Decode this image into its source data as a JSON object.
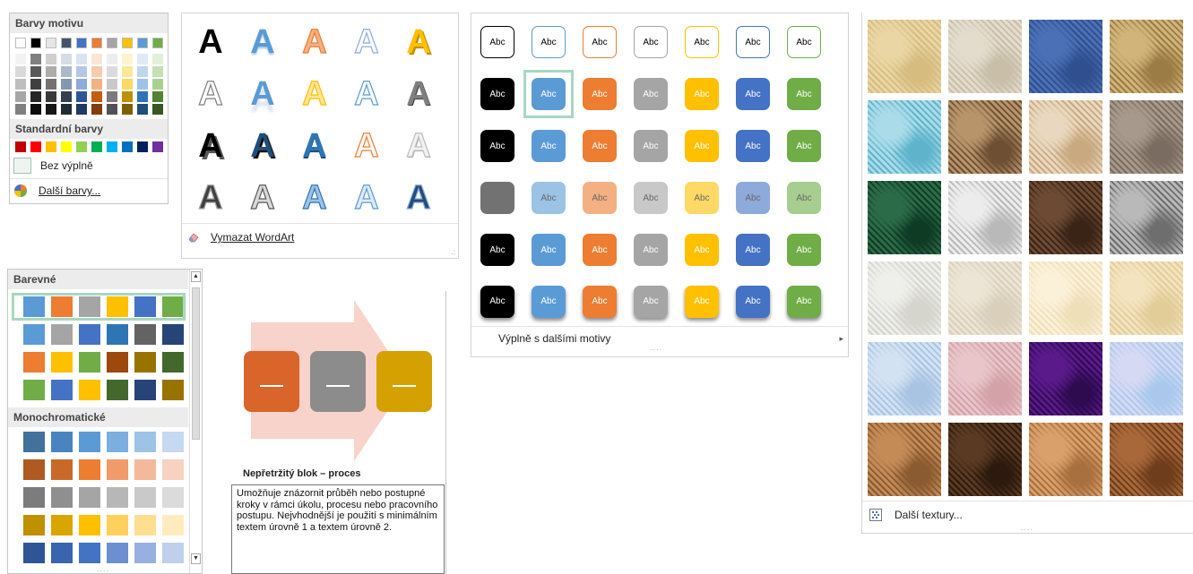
{
  "theme_colors": {
    "header": "Barvy motivu",
    "standard_header": "Standardní barvy",
    "no_fill_label": "Bez výplně",
    "more_colors_label": "Další barvy...",
    "top_row": [
      "#ffffff",
      "#000000",
      "#e7e6e6",
      "#44546a",
      "#4472c4",
      "#ed7d31",
      "#a5a5a5",
      "#ffc000",
      "#5b9bd5",
      "#70ad47"
    ],
    "shade_columns": [
      [
        "#f2f2f2",
        "#d9d9d9",
        "#bfbfbf",
        "#a6a6a6",
        "#808080"
      ],
      [
        "#808080",
        "#595959",
        "#404040",
        "#262626",
        "#0d0d0d"
      ],
      [
        "#d0cece",
        "#aeabab",
        "#757171",
        "#3a3838",
        "#171616"
      ],
      [
        "#d6dce4",
        "#adb9ca",
        "#8497b0",
        "#333f4f",
        "#222a35"
      ],
      [
        "#dae3f3",
        "#b4c7e7",
        "#8faadc",
        "#2f5597",
        "#203864"
      ],
      [
        "#fbe5d6",
        "#f8cbad",
        "#f4b183",
        "#c55a11",
        "#843c0c"
      ],
      [
        "#ededed",
        "#dbdbdb",
        "#c9c9c9",
        "#7b7b7b",
        "#525252"
      ],
      [
        "#fff2cc",
        "#ffe699",
        "#ffd966",
        "#bf9000",
        "#7f6000"
      ],
      [
        "#deebf7",
        "#bdd7ee",
        "#9dc3e6",
        "#2e75b6",
        "#1f4e79"
      ],
      [
        "#e2f0d9",
        "#c5e0b4",
        "#a9d18e",
        "#548235",
        "#385723"
      ]
    ],
    "standard_row": [
      "#c00000",
      "#ff0000",
      "#ffc000",
      "#ffff00",
      "#92d050",
      "#00b050",
      "#00b0f0",
      "#0070c0",
      "#002060",
      "#7030a0"
    ]
  },
  "wordart": {
    "glyph": "A",
    "clear_label": "Vymazat WordArt",
    "styles": [
      {
        "fill": "#000000",
        "stroke": "none",
        "shadow": "none"
      },
      {
        "fill": "#5b9bd5",
        "stroke": "none",
        "shadow": "0 2px 2px #9dc3e6"
      },
      {
        "fill": "#f4b183",
        "stroke": "#ed7d31",
        "shadow": "none"
      },
      {
        "fill": "#ffffff",
        "stroke": "#8faadc",
        "shadow": "none"
      },
      {
        "fill": "#ffc000",
        "stroke": "none",
        "shadow": "2px 2px 0 #bf9000"
      },
      {
        "fill": "#ffffff",
        "stroke": "#7f7f7f",
        "shadow": "none"
      },
      {
        "fill": "#5b9bd5",
        "stroke": "none",
        "shadow": "0 8px 3px #dae3f3"
      },
      {
        "fill": "#ffe699",
        "stroke": "#ffc000",
        "shadow": "none"
      },
      {
        "fill": "#ffffff",
        "stroke": "#5b9bd5",
        "shadow": "none"
      },
      {
        "fill": "#7f7f7f",
        "stroke": "none",
        "shadow": "1px 1px 0 #404040"
      },
      {
        "fill": "#000000",
        "stroke": "none",
        "shadow": "3px 3px 0 #595959"
      },
      {
        "fill": "#1f4e79",
        "stroke": "none",
        "shadow": "2px 2px 1px #000000"
      },
      {
        "fill": "#2e75b6",
        "stroke": "none",
        "shadow": "0 2px 0 #1f4e79"
      },
      {
        "fill": "#ffffff",
        "stroke": "#ed7d31",
        "shadow": "none"
      },
      {
        "fill": "#f2f2f2",
        "stroke": "#bfbfbf",
        "shadow": "1px 1px 0 #a6a6a6"
      },
      {
        "fill": "#404040",
        "stroke": "#a6a6a6",
        "shadow": "none"
      },
      {
        "fill": "#d9d9d9",
        "stroke": "#595959",
        "shadow": "none"
      },
      {
        "fill": "#9dc3e6",
        "stroke": "#2e75b6",
        "shadow": "none"
      },
      {
        "fill": "#deebf7",
        "stroke": "#5b9bd5",
        "shadow": "none"
      },
      {
        "fill": "#1f4e79",
        "stroke": "#8faadc",
        "shadow": "none"
      }
    ]
  },
  "shape_styles": {
    "label": "Abc",
    "more_label": "Výplně s dalšími motivy",
    "dots": "....",
    "colors": [
      "#000000",
      "#5b9bd5",
      "#ed7d31",
      "#a5a5a5",
      "#ffc000",
      "#4472c4",
      "#70ad47"
    ],
    "rows": [
      "outline",
      "solid",
      "solid",
      "light",
      "solid",
      "shadow"
    ],
    "selected": {
      "row": 1,
      "col": 1
    }
  },
  "textures": {
    "more_label": "Další textury...",
    "dots": "....",
    "tiles": [
      {
        "name": "papyrus",
        "c1": "#e9d6a4",
        "c2": "#d6bc7f"
      },
      {
        "name": "canvas",
        "c1": "#e3dccd",
        "c2": "#c9bfa8"
      },
      {
        "name": "denim",
        "c1": "#4b70b5",
        "c2": "#2f4f8f"
      },
      {
        "name": "woven-mat",
        "c1": "#d1b47a",
        "c2": "#9b7c45"
      },
      {
        "name": "water-droplets",
        "c1": "#a9dbe8",
        "c2": "#5fb4cc"
      },
      {
        "name": "paper-bag",
        "c1": "#b8946a",
        "c2": "#6d5034"
      },
      {
        "name": "fish-fossil",
        "c1": "#e9d8bf",
        "c2": "#c9a97f"
      },
      {
        "name": "sand",
        "c1": "#a7998b",
        "c2": "#7a6c60"
      },
      {
        "name": "green-marble",
        "c1": "#2c6b48",
        "c2": "#0e3b24"
      },
      {
        "name": "white-marble",
        "c1": "#ececec",
        "c2": "#b9b9b9"
      },
      {
        "name": "brown-marble",
        "c1": "#6d4a33",
        "c2": "#3a2416"
      },
      {
        "name": "granite",
        "c1": "#b9b9b9",
        "c2": "#6e6e6e"
      },
      {
        "name": "newsprint",
        "c1": "#eeeeea",
        "c2": "#d5d5ce"
      },
      {
        "name": "recycled-paper",
        "c1": "#ece4d5",
        "c2": "#d9cfbb"
      },
      {
        "name": "parchment",
        "c1": "#fbf1d9",
        "c2": "#efdfb9"
      },
      {
        "name": "stationery",
        "c1": "#f3e3bf",
        "c2": "#e2cc98"
      },
      {
        "name": "blue-tissue-paper",
        "c1": "#d2e2f2",
        "c2": "#a9c4e3"
      },
      {
        "name": "pink-tissue-paper",
        "c1": "#e8c5c8",
        "c2": "#d3a2a8"
      },
      {
        "name": "purple-mesh",
        "c1": "#5a1a8a",
        "c2": "#2e0a4f"
      },
      {
        "name": "bouquet",
        "c1": "#d6d9f3",
        "c2": "#a9c9ec"
      },
      {
        "name": "cork",
        "c1": "#c48b57",
        "c2": "#8a5a30"
      },
      {
        "name": "walnut",
        "c1": "#5a3a22",
        "c2": "#2d1a0e"
      },
      {
        "name": "oak",
        "c1": "#d9a06b",
        "c2": "#a8703e"
      },
      {
        "name": "medium-wood",
        "c1": "#a8683a",
        "c2": "#6e3d1c"
      }
    ]
  },
  "color_variations": {
    "colorful_header": "Barevné",
    "mono_header": "Monochromatické",
    "dots": "....",
    "colorful_rows": [
      [
        "#5b9bd5",
        "#ed7d31",
        "#a5a5a5",
        "#ffc000",
        "#4472c4",
        "#70ad47"
      ],
      [
        "#5b9bd5",
        "#a5a5a5",
        "#4472c4",
        "#2e75b6",
        "#636363",
        "#264478"
      ],
      [
        "#ed7d31",
        "#ffc000",
        "#70ad47",
        "#9e480e",
        "#997300",
        "#43682b"
      ],
      [
        "#70ad47",
        "#4472c4",
        "#ffc000",
        "#43682b",
        "#264478",
        "#997300"
      ]
    ],
    "mono_rows": [
      [
        "#41719c",
        "#4a84c0",
        "#5b9bd5",
        "#7cafe0",
        "#9dc3e6",
        "#c5d9f0"
      ],
      [
        "#ae5a21",
        "#c8692a",
        "#ed7d31",
        "#f19a6a",
        "#f4b89a",
        "#f8d2c0"
      ],
      [
        "#7c7c7c",
        "#8f8f8f",
        "#a5a5a5",
        "#b7b7b7",
        "#c9c9c9",
        "#dbdbdb"
      ],
      [
        "#bf9000",
        "#dba500",
        "#ffc000",
        "#ffd05c",
        "#ffde8f",
        "#ffebbd"
      ],
      [
        "#2f5597",
        "#3864b0",
        "#4472c4",
        "#6d8fd1",
        "#98b0df",
        "#c0cfec"
      ]
    ],
    "selected_row": 0
  },
  "smartart": {
    "title": "Nepřetržitý blok – proces",
    "description": "Umožňuje znázornit průběh nebo postupné kroky v rámci úkolu, procesu nebo pracovního postupu. Nejvhodnější je použití s minimálním textem úrovně 1 a textem úrovně 2.",
    "arrow_color": "#f8d3cc",
    "blocks": [
      "#d9652a",
      "#8c8c8c",
      "#d4a100"
    ]
  }
}
